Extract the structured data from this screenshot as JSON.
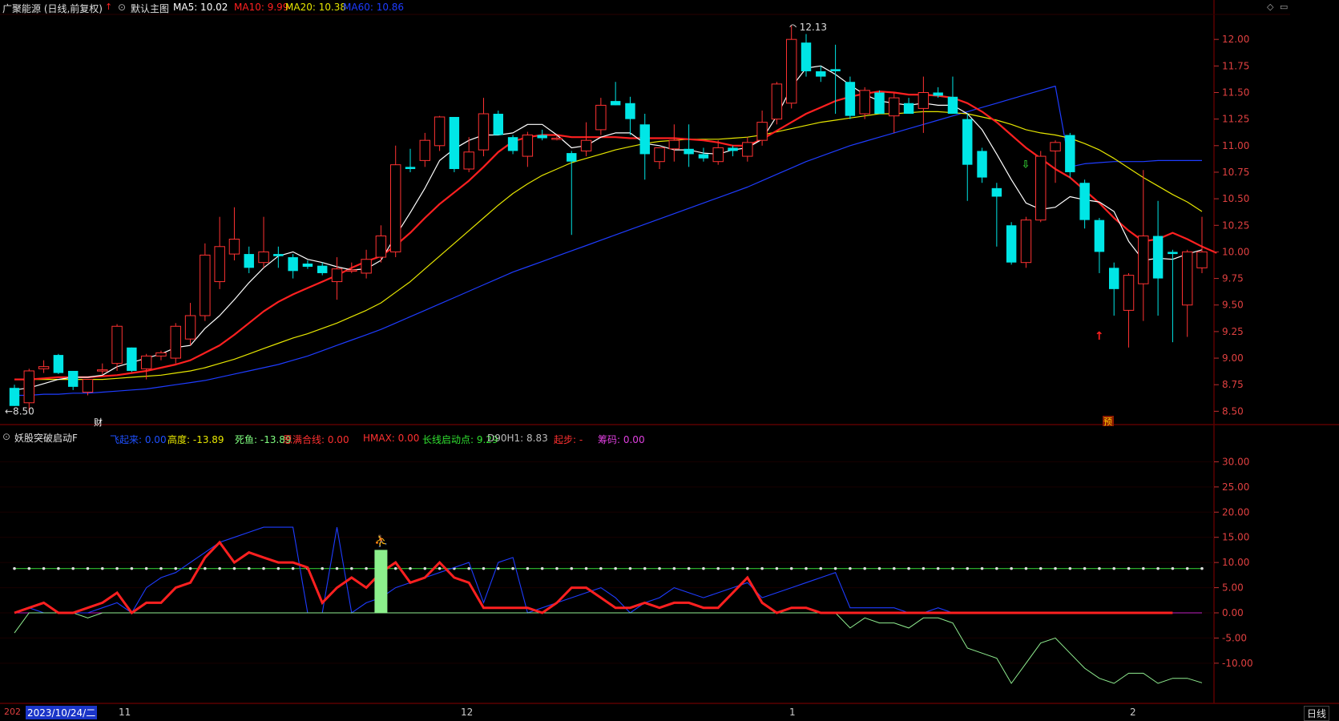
{
  "header": {
    "stock_title": "广聚能源 (日线,前复权)",
    "main_chart_label": "默认主图",
    "ma5": "MA5: 10.02",
    "ma10": "MA10: 9.99",
    "ma20": "MA20: 10.38",
    "ma60": "MA60: 10.86"
  },
  "indicator": {
    "name": "妖股突破启动F",
    "values": [
      {
        "text": "飞起来: 0.00",
        "color": "#1e50ff"
      },
      {
        "text": "高度: -13.89",
        "color": "#e8e800"
      },
      {
        "text": "死鱼: -13.89",
        "color": "#80ff80"
      },
      {
        "text": "思满合线: 0.00",
        "color": "#ff3030"
      },
      {
        "text": "HMAX: 0.00",
        "color": "#ff3030"
      },
      {
        "text": "长线启动点: 9.29",
        "color": "#30e030"
      },
      {
        "text": "D90H1: 8.83",
        "color": "#bdbdbd"
      },
      {
        "text": "起步: -",
        "color": "#ff3030"
      },
      {
        "text": "筹码: 0.00",
        "color": "#e040e0"
      }
    ]
  },
  "price_axis": {
    "ticks": [
      "12.00",
      "11.75",
      "11.50",
      "11.25",
      "11.00",
      "10.75",
      "10.50",
      "10.25",
      "10.00",
      "9.75",
      "9.50",
      "9.25",
      "9.00",
      "8.75",
      "8.50"
    ],
    "annotations": {
      "high": "12.13",
      "low": "8.50"
    }
  },
  "indicator_axis": {
    "ticks": [
      "30.00",
      "25.00",
      "20.00",
      "15.00",
      "10.00",
      "5.00",
      "0.00",
      "-5.00",
      "-10.00"
    ]
  },
  "markers": {
    "finance": "财",
    "forecast": "预"
  },
  "date_axis": {
    "year_stub": "202",
    "cursor_date": "2023/10/24/二",
    "month_labels": [
      "11",
      "12",
      "1",
      "2"
    ]
  },
  "period_button": "日线",
  "colors": {
    "up": "#ff3232",
    "down": "#00e6e6",
    "ma5": "#ffffff",
    "ma10": "#ff2020",
    "ma20": "#e6e600",
    "ma60": "#1e3cff",
    "grid": "#5a0000"
  },
  "chart_data": {
    "type": "candlestick",
    "candles": [
      {
        "o": 8.72,
        "h": 8.75,
        "l": 8.55,
        "c": 8.55
      },
      {
        "o": 8.58,
        "h": 8.9,
        "l": 8.5,
        "c": 8.88
      },
      {
        "o": 8.9,
        "h": 8.98,
        "l": 8.86,
        "c": 8.92
      },
      {
        "o": 9.03,
        "h": 9.04,
        "l": 8.85,
        "c": 8.86
      },
      {
        "o": 8.88,
        "h": 8.88,
        "l": 8.7,
        "c": 8.73
      },
      {
        "o": 8.68,
        "h": 8.8,
        "l": 8.65,
        "c": 8.8
      },
      {
        "o": 8.88,
        "h": 8.95,
        "l": 8.85,
        "c": 8.89
      },
      {
        "o": 8.95,
        "h": 9.32,
        "l": 8.88,
        "c": 9.3
      },
      {
        "o": 9.1,
        "h": 9.1,
        "l": 8.87,
        "c": 8.88
      },
      {
        "o": 8.9,
        "h": 9.04,
        "l": 8.8,
        "c": 9.02
      },
      {
        "o": 9.02,
        "h": 9.07,
        "l": 8.98,
        "c": 9.05
      },
      {
        "o": 9.0,
        "h": 9.33,
        "l": 8.95,
        "c": 9.3
      },
      {
        "o": 9.18,
        "h": 9.52,
        "l": 9.12,
        "c": 9.4
      },
      {
        "o": 9.4,
        "h": 10.08,
        "l": 9.35,
        "c": 9.97
      },
      {
        "o": 9.72,
        "h": 10.33,
        "l": 9.65,
        "c": 10.05
      },
      {
        "o": 9.98,
        "h": 10.42,
        "l": 9.92,
        "c": 10.12
      },
      {
        "o": 9.98,
        "h": 10.05,
        "l": 9.8,
        "c": 9.85
      },
      {
        "o": 9.9,
        "h": 10.33,
        "l": 9.85,
        "c": 10.0
      },
      {
        "o": 9.98,
        "h": 10.05,
        "l": 9.85,
        "c": 9.96
      },
      {
        "o": 9.95,
        "h": 9.98,
        "l": 9.75,
        "c": 9.82
      },
      {
        "o": 9.89,
        "h": 9.92,
        "l": 9.84,
        "c": 9.86
      },
      {
        "o": 9.87,
        "h": 9.9,
        "l": 9.78,
        "c": 9.8
      },
      {
        "o": 9.72,
        "h": 9.95,
        "l": 9.55,
        "c": 9.84
      },
      {
        "o": 9.82,
        "h": 9.9,
        "l": 9.8,
        "c": 9.83
      },
      {
        "o": 9.8,
        "h": 10.02,
        "l": 9.75,
        "c": 9.93
      },
      {
        "o": 9.95,
        "h": 10.25,
        "l": 9.9,
        "c": 10.15
      },
      {
        "o": 10.0,
        "h": 11.0,
        "l": 9.95,
        "c": 10.82
      },
      {
        "o": 10.8,
        "h": 10.97,
        "l": 10.75,
        "c": 10.78
      },
      {
        "o": 10.86,
        "h": 11.12,
        "l": 10.8,
        "c": 11.05
      },
      {
        "o": 11.0,
        "h": 11.28,
        "l": 10.95,
        "c": 11.27
      },
      {
        "o": 11.27,
        "h": 11.27,
        "l": 10.75,
        "c": 10.78
      },
      {
        "o": 10.78,
        "h": 11.08,
        "l": 10.75,
        "c": 10.94
      },
      {
        "o": 10.96,
        "h": 11.45,
        "l": 10.9,
        "c": 11.3
      },
      {
        "o": 11.3,
        "h": 11.33,
        "l": 11.1,
        "c": 11.1
      },
      {
        "o": 11.08,
        "h": 11.1,
        "l": 10.92,
        "c": 10.95
      },
      {
        "o": 10.9,
        "h": 11.13,
        "l": 10.8,
        "c": 11.1
      },
      {
        "o": 11.1,
        "h": 11.15,
        "l": 11.05,
        "c": 11.07
      },
      {
        "o": 11.07,
        "h": 11.1,
        "l": 11.05,
        "c": 11.07
      },
      {
        "o": 10.93,
        "h": 10.95,
        "l": 10.16,
        "c": 10.85
      },
      {
        "o": 10.95,
        "h": 11.22,
        "l": 10.9,
        "c": 11.05
      },
      {
        "o": 11.15,
        "h": 11.45,
        "l": 11.1,
        "c": 11.38
      },
      {
        "o": 11.42,
        "h": 11.6,
        "l": 11.38,
        "c": 11.38
      },
      {
        "o": 11.4,
        "h": 11.46,
        "l": 11.1,
        "c": 11.25
      },
      {
        "o": 11.2,
        "h": 11.3,
        "l": 10.68,
        "c": 10.92
      },
      {
        "o": 10.85,
        "h": 10.95,
        "l": 10.78,
        "c": 10.98
      },
      {
        "o": 10.97,
        "h": 11.2,
        "l": 10.85,
        "c": 11.05
      },
      {
        "o": 10.97,
        "h": 11.2,
        "l": 10.8,
        "c": 10.92
      },
      {
        "o": 10.92,
        "h": 10.98,
        "l": 10.85,
        "c": 10.88
      },
      {
        "o": 10.85,
        "h": 11.05,
        "l": 10.82,
        "c": 10.98
      },
      {
        "o": 10.98,
        "h": 11.0,
        "l": 10.9,
        "c": 10.95
      },
      {
        "o": 10.9,
        "h": 11.08,
        "l": 10.85,
        "c": 11.03
      },
      {
        "o": 11.05,
        "h": 11.33,
        "l": 11.0,
        "c": 11.22
      },
      {
        "o": 11.25,
        "h": 11.6,
        "l": 11.2,
        "c": 11.58
      },
      {
        "o": 11.4,
        "h": 12.13,
        "l": 11.35,
        "c": 12.0
      },
      {
        "o": 11.97,
        "h": 12.05,
        "l": 11.65,
        "c": 11.7
      },
      {
        "o": 11.7,
        "h": 11.75,
        "l": 11.6,
        "c": 11.65
      },
      {
        "o": 11.72,
        "h": 11.95,
        "l": 11.3,
        "c": 11.7
      },
      {
        "o": 11.6,
        "h": 11.65,
        "l": 11.25,
        "c": 11.28
      },
      {
        "o": 11.3,
        "h": 11.55,
        "l": 11.25,
        "c": 11.52
      },
      {
        "o": 11.5,
        "h": 11.52,
        "l": 11.3,
        "c": 11.3
      },
      {
        "o": 11.28,
        "h": 11.5,
        "l": 11.12,
        "c": 11.45
      },
      {
        "o": 11.4,
        "h": 11.45,
        "l": 11.3,
        "c": 11.3
      },
      {
        "o": 11.35,
        "h": 11.65,
        "l": 11.12,
        "c": 11.5
      },
      {
        "o": 11.5,
        "h": 11.55,
        "l": 11.45,
        "c": 11.47
      },
      {
        "o": 11.46,
        "h": 11.65,
        "l": 11.3,
        "c": 11.3
      },
      {
        "o": 11.25,
        "h": 11.3,
        "l": 10.48,
        "c": 10.82
      },
      {
        "o": 10.95,
        "h": 10.98,
        "l": 10.65,
        "c": 10.7
      },
      {
        "o": 10.6,
        "h": 10.65,
        "l": 10.05,
        "c": 10.52
      },
      {
        "o": 10.25,
        "h": 10.28,
        "l": 9.88,
        "c": 9.9
      },
      {
        "o": 9.9,
        "h": 10.33,
        "l": 9.85,
        "c": 10.3
      },
      {
        "o": 10.3,
        "h": 10.95,
        "l": 10.28,
        "c": 10.9
      },
      {
        "o": 10.95,
        "h": 11.05,
        "l": 10.65,
        "c": 11.03
      },
      {
        "o": 11.1,
        "h": 11.12,
        "l": 10.7,
        "c": 10.75
      },
      {
        "o": 10.65,
        "h": 10.68,
        "l": 10.22,
        "c": 10.3
      },
      {
        "o": 10.3,
        "h": 10.32,
        "l": 9.8,
        "c": 10.0
      },
      {
        "o": 9.85,
        "h": 9.9,
        "l": 9.4,
        "c": 9.65
      },
      {
        "o": 9.45,
        "h": 9.8,
        "l": 9.1,
        "c": 9.78
      },
      {
        "o": 9.7,
        "h": 10.77,
        "l": 9.35,
        "c": 10.15
      },
      {
        "o": 10.15,
        "h": 10.48,
        "l": 9.4,
        "c": 9.75
      },
      {
        "o": 10.0,
        "h": 10.02,
        "l": 9.15,
        "c": 9.98
      },
      {
        "o": 9.5,
        "h": 10.02,
        "l": 9.2,
        "c": 10.0
      },
      {
        "o": 9.85,
        "h": 10.33,
        "l": 9.8,
        "c": 10.0
      }
    ],
    "ma5": [
      8.7,
      8.72,
      8.76,
      8.8,
      8.82,
      8.82,
      8.84,
      8.92,
      8.96,
      9.0,
      9.04,
      9.1,
      9.12,
      9.28,
      9.4,
      9.55,
      9.71,
      9.85,
      9.96,
      10.0,
      9.93,
      9.9,
      9.86,
      9.83,
      9.84,
      9.92,
      10.15,
      10.37,
      10.6,
      10.86,
      10.97,
      11.05,
      11.1,
      11.1,
      11.12,
      11.2,
      11.2,
      11.1,
      10.98,
      11.0,
      11.08,
      11.12,
      11.12,
      11.02,
      11.0,
      10.96,
      10.96,
      10.93,
      10.92,
      10.96,
      10.98,
      11.06,
      11.28,
      11.55,
      11.73,
      11.75,
      11.67,
      11.57,
      11.48,
      11.42,
      11.4,
      11.38,
      11.4,
      11.38,
      11.38,
      11.3,
      11.15,
      10.92,
      10.68,
      10.46,
      10.4,
      10.42,
      10.52,
      10.49,
      10.47,
      10.38,
      10.1,
      9.92,
      9.94,
      9.93,
      9.98,
      10.02
    ],
    "ma10": [
      8.8,
      8.8,
      8.81,
      8.82,
      8.82,
      8.82,
      8.83,
      8.84,
      8.86,
      8.88,
      8.91,
      8.94,
      8.98,
      9.05,
      9.12,
      9.22,
      9.33,
      9.44,
      9.53,
      9.6,
      9.66,
      9.72,
      9.78,
      9.85,
      9.91,
      9.96,
      10.06,
      10.18,
      10.32,
      10.45,
      10.56,
      10.67,
      10.8,
      10.94,
      11.04,
      11.08,
      11.1,
      11.1,
      11.08,
      11.08,
      11.08,
      11.08,
      11.07,
      11.07,
      11.07,
      11.07,
      11.06,
      11.05,
      11.03,
      11.0,
      11.0,
      11.06,
      11.14,
      11.22,
      11.3,
      11.36,
      11.42,
      11.46,
      11.49,
      11.51,
      11.5,
      11.48,
      11.48,
      11.47,
      11.45,
      11.4,
      11.32,
      11.22,
      11.1,
      10.98,
      10.88,
      10.78,
      10.7,
      10.58,
      10.46,
      10.32,
      10.2,
      10.1,
      10.12,
      10.18,
      10.12,
      10.05,
      9.99
    ],
    "ma20": [
      8.8,
      8.8,
      8.8,
      8.8,
      8.8,
      8.8,
      8.8,
      8.81,
      8.82,
      8.83,
      8.84,
      8.86,
      8.88,
      8.91,
      8.95,
      8.99,
      9.04,
      9.09,
      9.14,
      9.19,
      9.23,
      9.28,
      9.33,
      9.39,
      9.45,
      9.52,
      9.62,
      9.72,
      9.84,
      9.96,
      10.08,
      10.2,
      10.32,
      10.44,
      10.55,
      10.64,
      10.72,
      10.78,
      10.84,
      10.88,
      10.92,
      10.96,
      10.99,
      11.02,
      11.04,
      11.05,
      11.06,
      11.06,
      11.06,
      11.07,
      11.08,
      11.1,
      11.13,
      11.16,
      11.19,
      11.22,
      11.24,
      11.26,
      11.28,
      11.3,
      11.3,
      11.31,
      11.32,
      11.32,
      11.31,
      11.3,
      11.27,
      11.24,
      11.2,
      11.15,
      11.12,
      11.1,
      11.07,
      11.02,
      10.96,
      10.88,
      10.79,
      10.7,
      10.62,
      10.54,
      10.47,
      10.38
    ],
    "ma60": [
      8.65,
      8.65,
      8.66,
      8.66,
      8.67,
      8.67,
      8.68,
      8.69,
      8.7,
      8.71,
      8.73,
      8.75,
      8.77,
      8.79,
      8.82,
      8.85,
      8.88,
      8.91,
      8.94,
      8.98,
      9.02,
      9.07,
      9.12,
      9.17,
      9.22,
      9.27,
      9.33,
      9.39,
      9.45,
      9.51,
      9.57,
      9.63,
      9.69,
      9.75,
      9.81,
      9.86,
      9.91,
      9.96,
      10.01,
      10.06,
      10.11,
      10.16,
      10.21,
      10.26,
      10.31,
      10.36,
      10.41,
      10.46,
      10.51,
      10.56,
      10.61,
      10.67,
      10.73,
      10.79,
      10.85,
      10.9,
      10.95,
      11.0,
      11.04,
      11.08,
      11.12,
      11.16,
      11.2,
      11.24,
      11.28,
      11.32,
      11.36,
      11.4,
      11.44,
      11.48,
      11.52,
      11.56,
      10.8,
      10.83,
      10.84,
      10.85,
      10.85,
      10.85,
      10.86,
      10.86,
      10.86,
      10.86
    ],
    "ind_red": [
      0,
      1,
      2,
      0,
      0,
      1,
      2,
      4,
      0,
      2,
      2,
      5,
      6,
      11,
      14,
      10,
      12,
      11,
      10,
      10,
      9,
      2,
      5,
      7,
      5,
      8,
      10,
      6,
      7,
      10,
      7,
      6,
      1,
      1,
      1,
      1,
      0,
      2,
      5,
      5,
      3,
      1,
      1,
      2,
      1,
      2,
      2,
      1,
      1,
      4,
      7,
      2,
      0,
      1,
      1,
      0,
      0,
      0,
      0,
      0,
      0,
      0,
      0,
      0,
      0,
      0,
      0,
      0,
      0,
      0,
      0,
      0,
      0,
      0,
      0,
      0,
      0,
      0,
      0,
      0
    ],
    "ind_blue": [
      0,
      1,
      0,
      0,
      0,
      0,
      1,
      2,
      0,
      5,
      7,
      8,
      10,
      12,
      14,
      15,
      16,
      17,
      17,
      17,
      0,
      0,
      17,
      0,
      2,
      3,
      5,
      6,
      7,
      8,
      9,
      10,
      2,
      10,
      11,
      0,
      1,
      2,
      3,
      4,
      5,
      3,
      0,
      2,
      3,
      5,
      4,
      3,
      4,
      5,
      6,
      3,
      4,
      5,
      6,
      7,
      8,
      1,
      1,
      1,
      1,
      0,
      0,
      1,
      0,
      0,
      0,
      0,
      0,
      0,
      0,
      0,
      0,
      0,
      0,
      0,
      0,
      0,
      0,
      0
    ],
    "ind_green": [
      -4,
      0,
      0,
      0,
      0,
      -1,
      0,
      0,
      0,
      0,
      0,
      0,
      0,
      0,
      0,
      0,
      0,
      0,
      0,
      0,
      0,
      0,
      0,
      0,
      0,
      0,
      0,
      0,
      0,
      0,
      0,
      0,
      0,
      0,
      0,
      0,
      0,
      0,
      0,
      0,
      0,
      0,
      0,
      0,
      0,
      0,
      0,
      0,
      0,
      0,
      0,
      0,
      0,
      0,
      0,
      0,
      0,
      -3,
      -1,
      -2,
      -2,
      -3,
      -1,
      -1,
      -2,
      -7,
      -8,
      -9,
      -14,
      -10,
      -6,
      -5,
      -8,
      -11,
      -13,
      -14,
      -12,
      -12,
      -14,
      -13,
      -13,
      -13.89
    ],
    "ind_level_line": 8.8,
    "price_range": [
      8.45,
      12.22
    ],
    "indicator_range": [
      -17.5,
      35
    ]
  }
}
